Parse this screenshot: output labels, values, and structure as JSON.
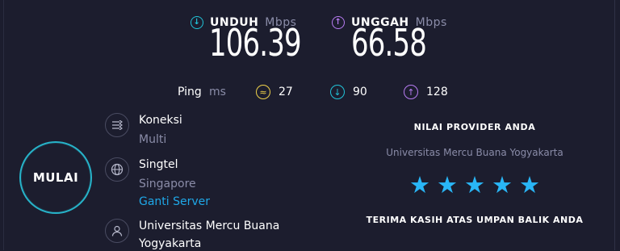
{
  "download": {
    "label": "UNDUH",
    "unit": "Mbps",
    "value": "106.39"
  },
  "upload": {
    "label": "UNGGAH",
    "unit": "Mbps",
    "value": "66.58"
  },
  "ping": {
    "label": "Ping",
    "unit": "ms",
    "idle": "27",
    "download": "90",
    "upload": "128"
  },
  "start_button": {
    "label": "MULAI"
  },
  "connection": {
    "title": "Koneksi",
    "value": "Multi"
  },
  "server": {
    "title": "Singtel",
    "location": "Singapore",
    "change_label": "Ganti Server"
  },
  "provider": {
    "line1": "Universitas Mercu Buana",
    "line2": "Yogyakarta"
  },
  "rating": {
    "title": "NILAI PROVIDER ANDA",
    "isp": "Universitas Mercu Buana Yogyakarta",
    "stars": 5,
    "thanks": "TERIMA KASIH ATAS UMPAN BALIK ANDA"
  },
  "colors": {
    "download": "#21c4d8",
    "upload": "#b77cf2",
    "idle": "#f0d24a",
    "accent": "#27b3c9",
    "star": "#29b6f6"
  },
  "icons": {
    "download": "arrow-down-circle-icon",
    "upload": "arrow-up-circle-icon",
    "idle": "gauge-icon",
    "connection": "connections-icon",
    "server": "globe-icon",
    "provider": "user-icon"
  }
}
